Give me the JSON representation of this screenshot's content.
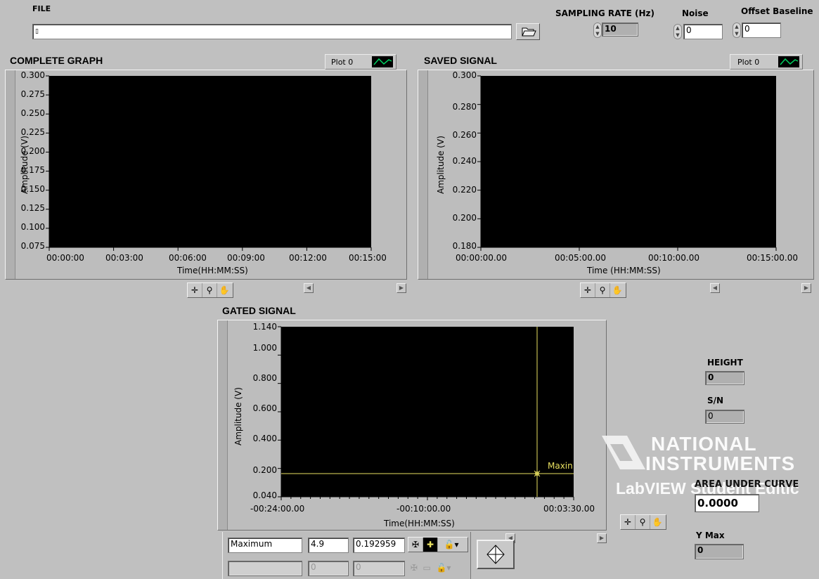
{
  "top": {
    "file_label": "FILE",
    "file_path": "",
    "file_icon": "path-icon",
    "browse_icon": "folder-open-icon",
    "sampling_label": "SAMPLING RATE (Hz)",
    "sampling_value": "10",
    "noise_label": "Noise",
    "noise_value": "0",
    "offset_label": "Offset Baseline",
    "offset_value": "0"
  },
  "complete": {
    "title": "COMPLETE GRAPH",
    "legend": "Plot 0",
    "ylabel": "Amplitude (V)",
    "xlabel": "Time(HH:MM:SS)",
    "yticks": [
      "0.300",
      "0.275",
      "0.250",
      "0.225",
      "0.200",
      "0.175",
      "0.150",
      "0.125",
      "0.100",
      "0.075"
    ],
    "xticks": [
      "00:00:00",
      "00:03:00",
      "00:06:00",
      "00:09:00",
      "00:12:00",
      "00:15:00"
    ]
  },
  "saved": {
    "title": "SAVED SIGNAL",
    "legend": "Plot 0",
    "ylabel": "Amplitude (V)",
    "xlabel": "Time (HH:MM:SS)",
    "yticks": [
      "0.300",
      "0.280",
      "0.260",
      "0.240",
      "0.220",
      "0.200",
      "0.180"
    ],
    "xticks": [
      "00:00:00.00",
      "00:05:00.00",
      "00:10:00.00",
      "00:15:00.00"
    ]
  },
  "gated": {
    "title": "GATED SIGNAL",
    "ylabel": "Amplitude (V)",
    "xlabel": "Time(HH:MM:SS)",
    "yticks": [
      "1.140",
      "1.000",
      "0.800",
      "0.600",
      "0.400",
      "0.200",
      "0.040"
    ],
    "xticks": [
      "-00:24:00.00",
      "-00:10:00.00",
      "00:03:30.00"
    ],
    "cursor_label": "Maxin",
    "cursor_color": "#e8e060",
    "cursor": {
      "name": "Maximum",
      "x": "4.9",
      "y": "0.192959"
    },
    "cursor2": {
      "name": "",
      "x": "0",
      "y": "0"
    }
  },
  "results": {
    "height_label": "HEIGHT",
    "height_value": "0",
    "sn_label": "S/N",
    "sn_value": "0",
    "area_label": "AREA UNDER CURVE",
    "area_value": "0.0000",
    "ymax_label": "Y Max",
    "ymax_value": "0"
  },
  "watermark": {
    "line1": "NATIONAL",
    "line2": "INSTRUMENTS",
    "line3": "LabVIEW Student Editic"
  },
  "colors": {
    "panel": "#c0c0c0",
    "plot_bg": "#000000",
    "cursor": "#e8e060",
    "legend_trace": "#00d060"
  }
}
